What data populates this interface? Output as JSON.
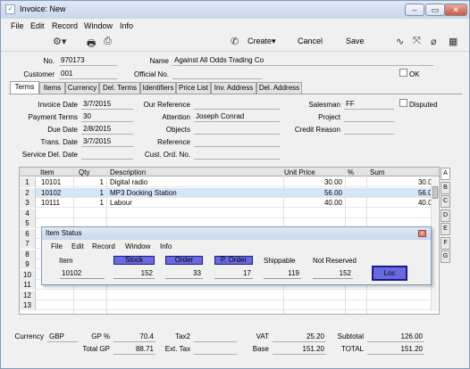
{
  "window": {
    "title": "Invoice: New"
  },
  "menu": [
    "File",
    "Edit",
    "Record",
    "Window",
    "Info"
  ],
  "toolbar": {
    "create": "Create",
    "cancel": "Cancel",
    "save": "Save"
  },
  "header": {
    "no_label": "No.",
    "no": "970173",
    "name_label": "Name",
    "name": "Against All Odds Trading Co",
    "customer_label": "Customer",
    "customer": "001",
    "official_label": "Official No.",
    "official": "",
    "ok_label": "OK"
  },
  "tabs": [
    "Terms",
    "Items",
    "Currency",
    "Del. Terms",
    "Identifiers",
    "Price List",
    "Inv. Address",
    "Del. Address"
  ],
  "terms": {
    "invoice_date_label": "Invoice Date",
    "invoice_date": "3/7/2015",
    "payment_terms_label": "Payment Terms",
    "payment_terms": "30",
    "due_date_label": "Due Date",
    "due_date": "2/8/2015",
    "trans_date_label": "Trans. Date",
    "trans_date": "3/7/2015",
    "service_del_label": "Service Del. Date",
    "service_del": "",
    "our_ref_label": "Our Reference",
    "our_ref": "",
    "attention_label": "Attention",
    "attention": "Joseph Conrad",
    "objects_label": "Objects",
    "objects": "",
    "reference_label": "Reference",
    "reference": "",
    "cust_ord_label": "Cust. Ord. No.",
    "cust_ord": "",
    "salesman_label": "Salesman",
    "salesman": "FF",
    "project_label": "Project",
    "project": "",
    "credit_label": "Credit Reason",
    "credit": "",
    "disputed_label": "Disputed"
  },
  "grid": {
    "columns": [
      "Item",
      "Qty",
      "Description",
      "Unit Price",
      "%",
      "Sum"
    ],
    "rows": [
      {
        "n": "1",
        "item": "10101",
        "qty": "1",
        "desc": "Digital radio",
        "price": "30.00",
        "pct": "",
        "sum": "30.00"
      },
      {
        "n": "2",
        "item": "10102",
        "qty": "1",
        "desc": "MP3 Docking Station",
        "price": "56.00",
        "pct": "",
        "sum": "56.00"
      },
      {
        "n": "3",
        "item": "10111",
        "qty": "1",
        "desc": "Labour",
        "price": "40.00",
        "pct": "",
        "sum": "40.00"
      },
      {
        "n": "4"
      },
      {
        "n": "5"
      },
      {
        "n": "6"
      },
      {
        "n": "7"
      },
      {
        "n": "8"
      },
      {
        "n": "9"
      },
      {
        "n": "10"
      },
      {
        "n": "11"
      },
      {
        "n": "12"
      },
      {
        "n": "13"
      }
    ],
    "side_tabs": [
      "A",
      "B",
      "C",
      "D",
      "E",
      "F",
      "G"
    ]
  },
  "item_status": {
    "title": "Item Status",
    "menu": [
      "File",
      "Edit",
      "Record",
      "Window",
      "Info"
    ],
    "item_label": "Item",
    "item": "10102",
    "stock_label": "Stock",
    "stock": "152",
    "order_label": "Order",
    "order": "33",
    "porder_label": "P. Order",
    "porder": "17",
    "shippable_label": "Shippable",
    "shippable": "119",
    "not_reserved_label": "Not Reserved",
    "not_reserved": "152",
    "loc_label": "Loc"
  },
  "totals": {
    "currency_label": "Currency",
    "currency": "GBP",
    "gp_pct_label": "GP %",
    "gp_pct": "70.4",
    "tax2_label": "Tax2",
    "tax2": "",
    "vat_label": "VAT",
    "vat": "25.20",
    "subtotal_label": "Subtotal",
    "subtotal": "126.00",
    "total_gp_label": "Total GP",
    "total_gp": "88.71",
    "ext_tax_label": "Ext. Tax",
    "ext_tax": "",
    "base_label": "Base",
    "base": "151.20",
    "total_label": "TOTAL",
    "total": "151.20"
  },
  "colors": {
    "accent_button": "#6a6ae0",
    "selected_row": "#d4e5f7"
  }
}
